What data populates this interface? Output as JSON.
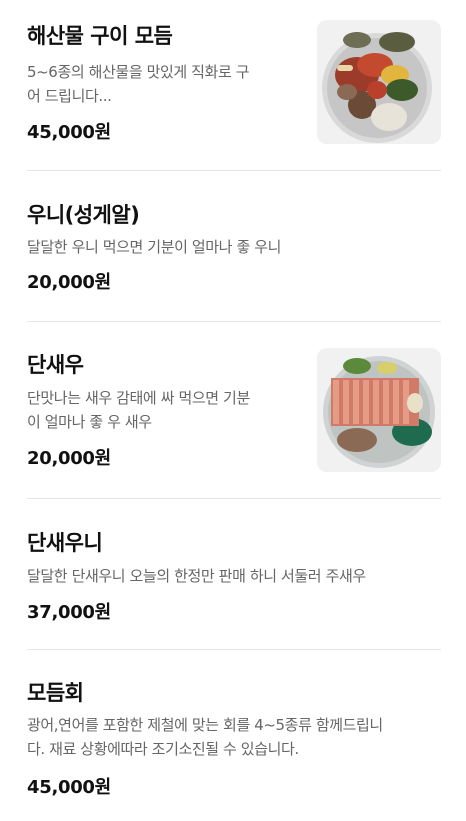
{
  "menu": {
    "items": [
      {
        "name": "해산물 구이 모듬",
        "description_lines": [
          "5~6종의 해산물을 맛있게 직화로 구",
          "어 드립니다..."
        ],
        "price": "45,000원",
        "image": "seafood-grill-platter-photo"
      },
      {
        "name": "우니(성게알)",
        "description_lines": [
          "달달한 우니 먹으면 기분이 얼마나 좋 우니"
        ],
        "price": "20,000원"
      },
      {
        "name": "단새우",
        "description_lines": [
          "단맛나는 새우 감태에 싸 먹으면 기분",
          "이 얼마나 좋 우 새우"
        ],
        "price": "20,000원",
        "image": "sweet-shrimp-platter-photo"
      },
      {
        "name": "단새우니",
        "description_lines": [
          "달달한 단새우니 오늘의 한정만 판매 하니 서둘러 주새우"
        ],
        "price": "37,000원"
      },
      {
        "name": "모듬회",
        "description_lines": [
          "광어,연어를 포함한 제철에 맞는 회를 4~5종류 함께드립니",
          "다. 재료 상황에따라 조기소진될 수 있습니다."
        ],
        "price": "45,000원"
      }
    ]
  },
  "colors": {
    "title": "#111111",
    "description": "#666666",
    "price": "#111111",
    "divider": "#e6e6e6"
  }
}
